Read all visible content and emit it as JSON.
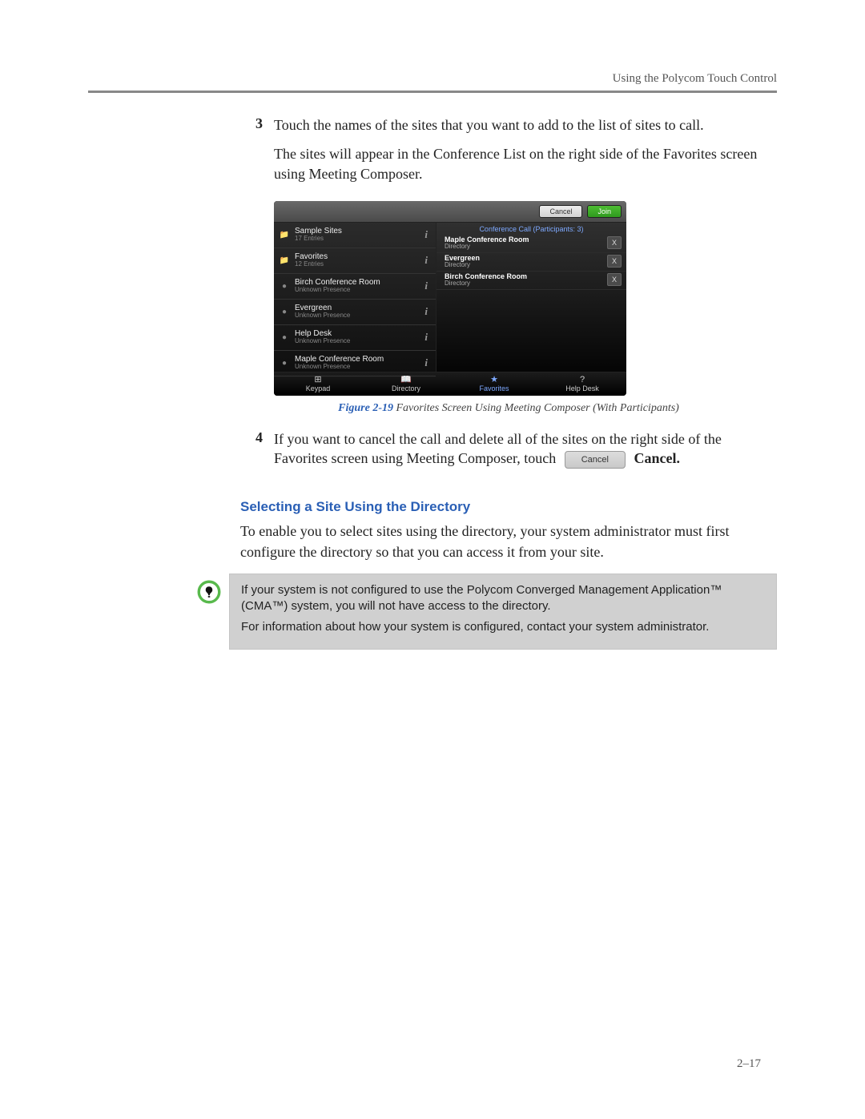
{
  "header": {
    "running_head": "Using the Polycom Touch Control"
  },
  "step3": {
    "num": "3",
    "p1": "Touch the names of the sites that you want to add to the list of sites to call.",
    "p2": "The sites will appear in the Conference List on the right side of the Favorites screen using Meeting Composer."
  },
  "figure": {
    "topbar": {
      "cancel": "Cancel",
      "join": "Join"
    },
    "left_items": [
      {
        "icon": "folder",
        "name": "Sample Sites",
        "sub": "17 Entries"
      },
      {
        "icon": "folder",
        "name": "Favorites",
        "sub": "12 Entries"
      },
      {
        "icon": "dot",
        "name": "Birch Conference Room",
        "sub": "Unknown Presence"
      },
      {
        "icon": "dot",
        "name": "Evergreen",
        "sub": "Unknown Presence"
      },
      {
        "icon": "dot",
        "name": "Help Desk",
        "sub": "Unknown Presence"
      },
      {
        "icon": "dot",
        "name": "Maple Conference Room",
        "sub": "Unknown Presence"
      }
    ],
    "conf_header": "Conference Call (Participants: 3)",
    "participants": [
      {
        "name": "Maple Conference Room",
        "sub": "Directory"
      },
      {
        "name": "Evergreen",
        "sub": "Directory"
      },
      {
        "name": "Birch Conference Room",
        "sub": "Directory"
      }
    ],
    "tabs": {
      "keypad": "Keypad",
      "directory": "Directory",
      "favorites": "Favorites",
      "helpdesk": "Help Desk"
    },
    "caption_no": "Figure 2-19",
    "caption_text": "  Favorites Screen Using Meeting Composer (With Participants)"
  },
  "step4": {
    "num": "4",
    "text_a": "If you want to cancel the call and delete all of the sites on the right side of the Favorites screen using Meeting Composer, touch ",
    "btn": "Cancel",
    "text_b": " Cancel."
  },
  "section": {
    "heading": "Selecting a Site Using the Directory",
    "intro": "To enable you to select sites using the directory, your system administrator must first configure the directory so that you can access it from your site."
  },
  "note": {
    "p1": "If your system is not configured to use the Polycom Converged Management Application™ (CMA™) system, you will not have access to the directory.",
    "p2": "For information about how your system is configured, contact your system administrator."
  },
  "page_number": "2–17"
}
